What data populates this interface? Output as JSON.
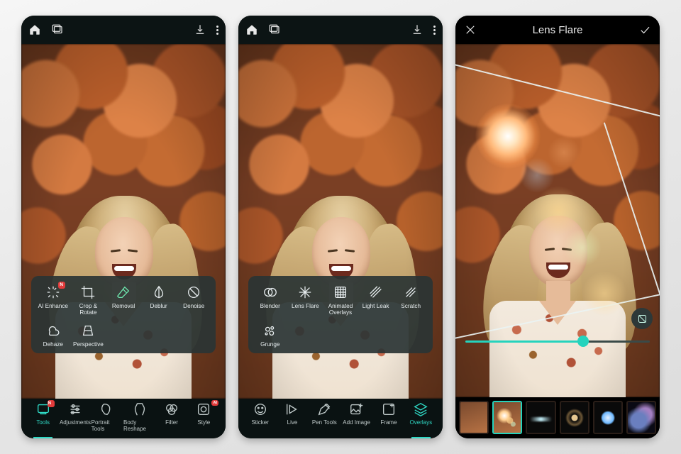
{
  "badge_new": "N",
  "badge_ai": "AI",
  "panel1": {
    "tools": {
      "ai_enhance": "AI Enhance",
      "crop_rotate": "Crop & Rotate",
      "removal": "Removal",
      "deblur": "Deblur",
      "denoise": "Denoise",
      "dehaze": "Dehaze",
      "perspective": "Perspective"
    },
    "nav": {
      "tools": "Tools",
      "adjustments": "Adjustments",
      "portrait_tools": "Portrait Tools",
      "body_reshape": "Body Reshape",
      "filter": "Filter",
      "style": "Style"
    }
  },
  "panel2": {
    "tools": {
      "blender": "Blender",
      "lens_flare": "Lens Flare",
      "animated_overlays": "Animated Overlays",
      "light_leak": "Light Leak",
      "scratch": "Scratch",
      "grunge": "Grunge"
    },
    "nav": {
      "sticker": "Sticker",
      "live": "Live",
      "pen_tools": "Pen Tools",
      "add_image": "Add Image",
      "frame": "Frame",
      "overlays": "Overlays"
    }
  },
  "panel3": {
    "title": "Lens Flare",
    "slider_percent": 64,
    "thumbs": [
      {
        "id": "original",
        "selected": false
      },
      {
        "id": "flare-warm-1",
        "selected": true
      },
      {
        "id": "flare-dark-1",
        "selected": false
      },
      {
        "id": "flare-ring",
        "selected": false
      },
      {
        "id": "flare-blue",
        "selected": false
      },
      {
        "id": "flare-nebula",
        "selected": false
      }
    ]
  }
}
